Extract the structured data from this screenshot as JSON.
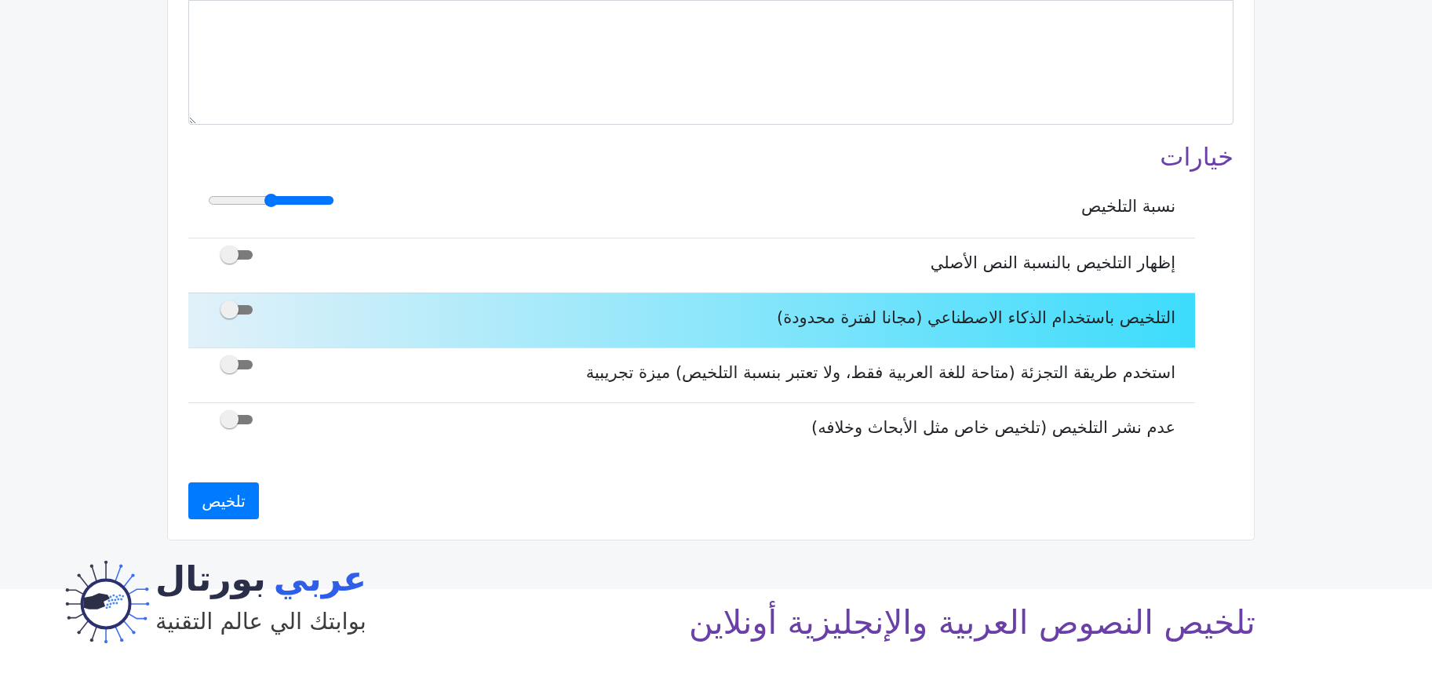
{
  "options_heading": "خيارات",
  "options": [
    {
      "kind": "slider",
      "label": "نسبة التلخيص",
      "level": 0.5,
      "highlighted": false
    },
    {
      "kind": "toggle",
      "label": "إظهار التلخيص بالنسبة النص الأصلي",
      "checked": false,
      "highlighted": false
    },
    {
      "kind": "toggle",
      "label": "التلخيص باستخدام الذكاء الاصطناعي (مجانا لفترة محدودة)",
      "checked": false,
      "highlighted": true
    },
    {
      "kind": "toggle",
      "label": "استخدم طريقة التجزئة (متاحة للغة العربية فقط، ولا تعتبر بنسبة التلخيص) ميزة تجريبية",
      "checked": false,
      "highlighted": false
    },
    {
      "kind": "toggle",
      "label": "عدم نشر التلخيص (تلخيص خاص مثل الأبحاث وخلافه)",
      "checked": false,
      "highlighted": false
    }
  ],
  "submit_button": "تلخيص",
  "footer": {
    "logo": {
      "words": [
        {
          "text": "عربي",
          "color": "#2f5fe8"
        },
        {
          "text": "بورتال",
          "color": "#2b2e48"
        }
      ],
      "tagline": "بوابتك الي عالم التقنية"
    },
    "title": "تلخيص النصوص العربية والإنجليزية أونلاين"
  }
}
